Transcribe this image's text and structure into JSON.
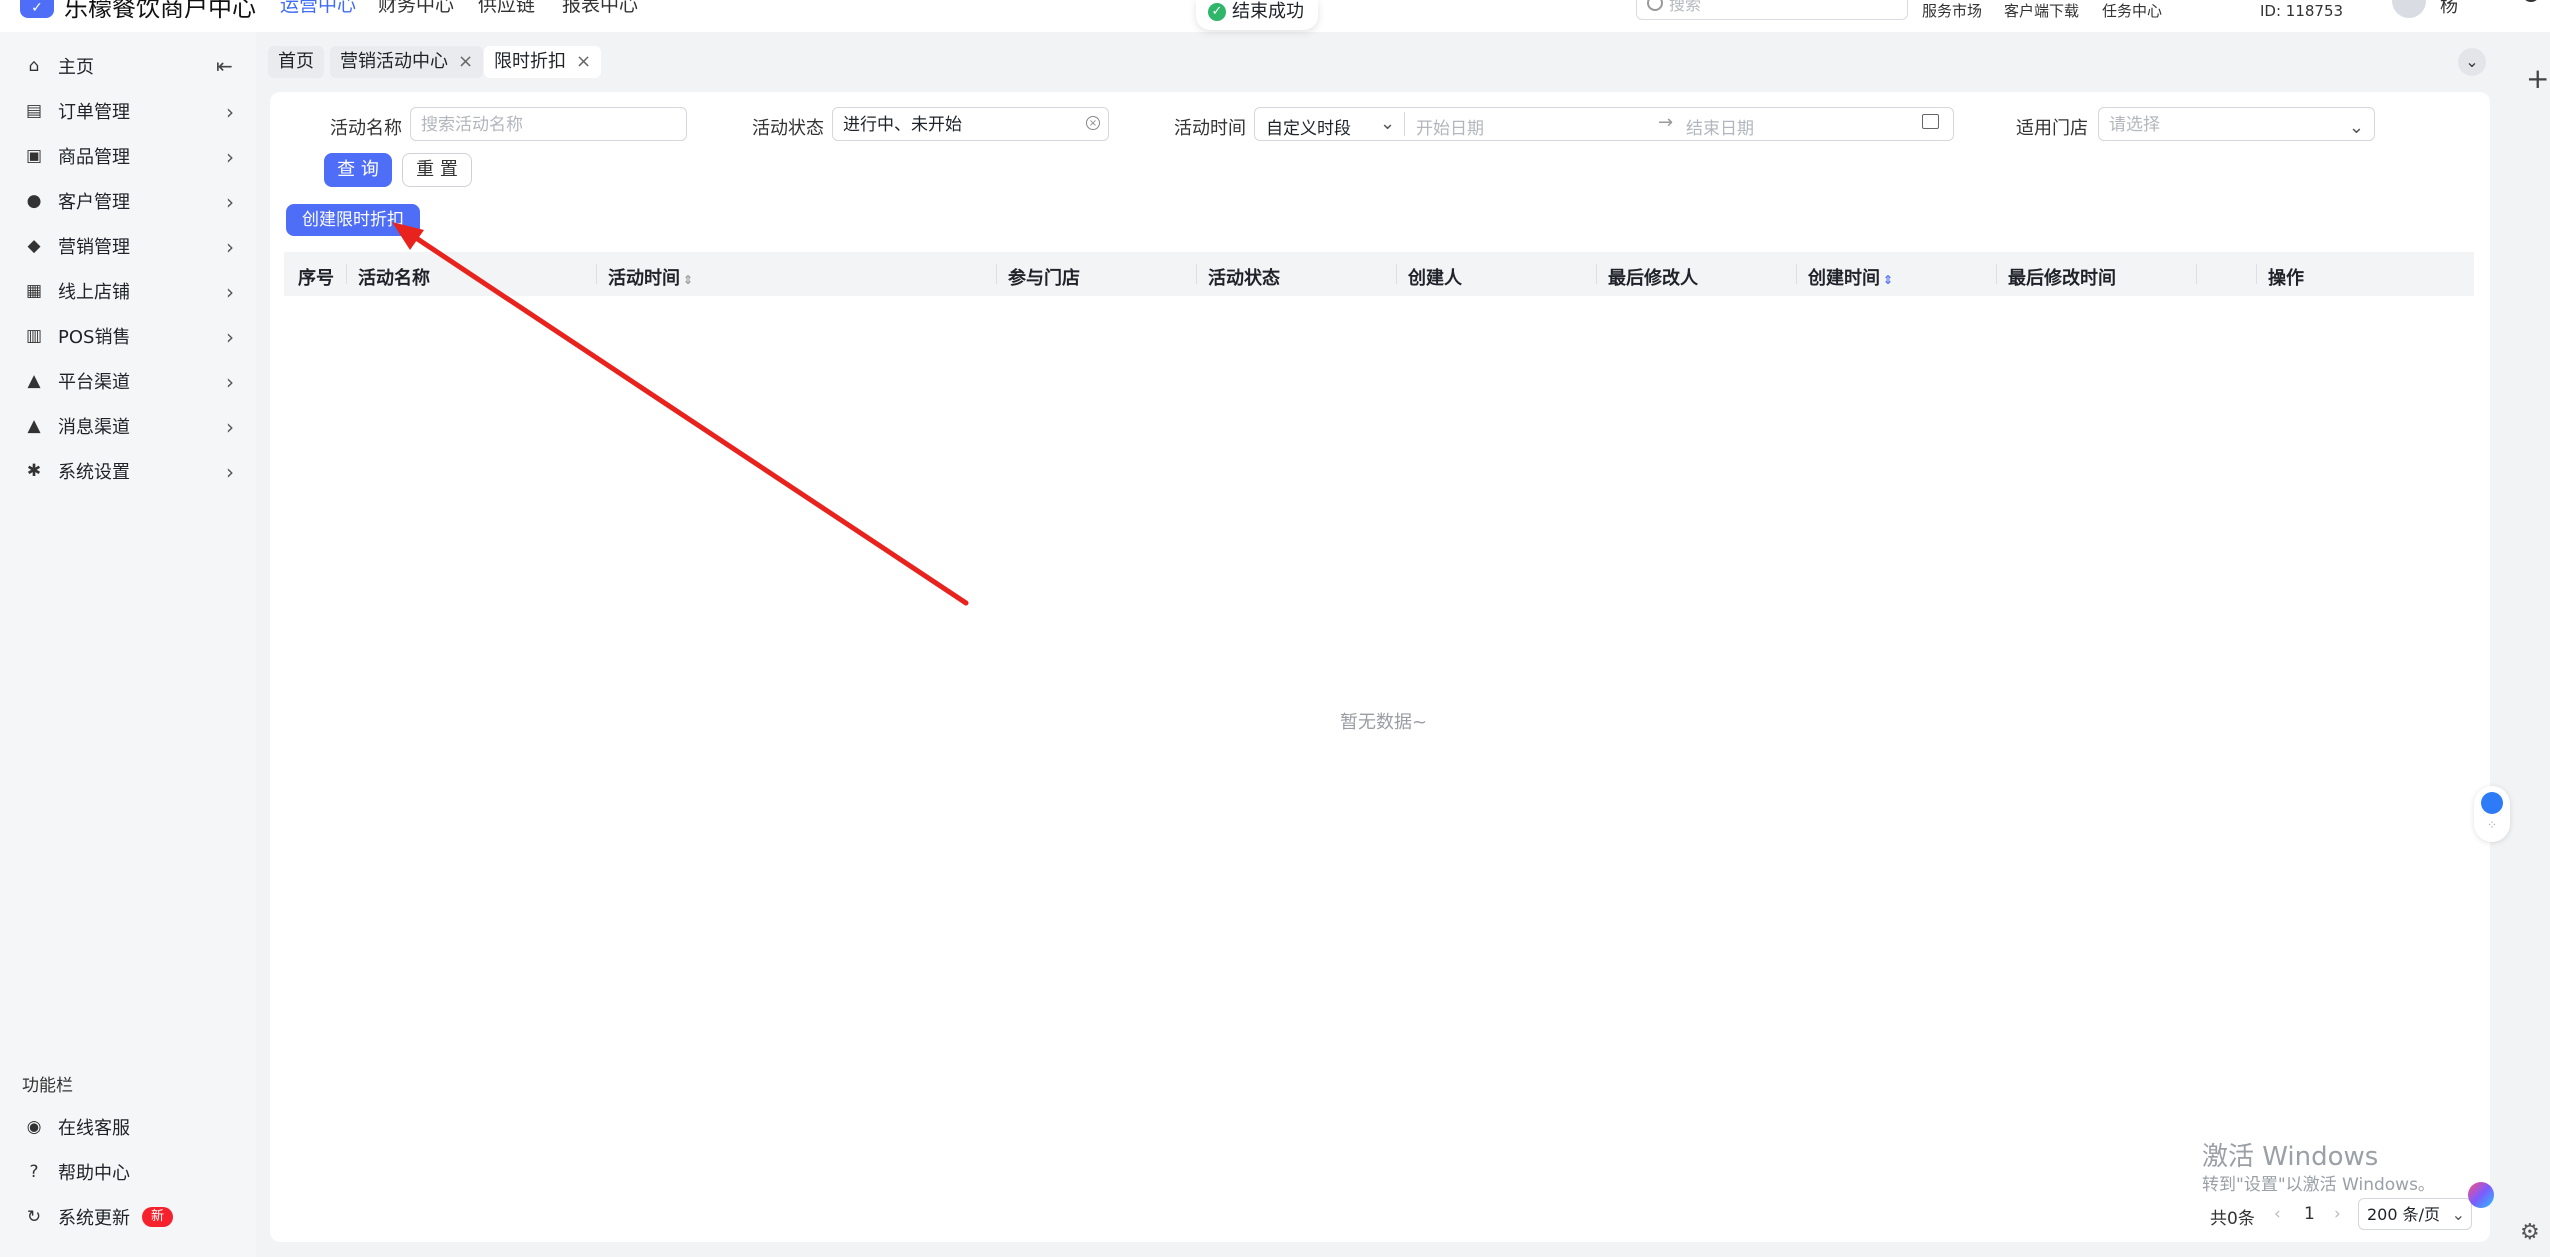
{
  "app": {
    "title": "乐檬餐饮商户中心",
    "logo_glyph": "✓"
  },
  "top_nav": [
    "运营中心",
    "财务中心",
    "供应链",
    "报表中心"
  ],
  "toast": {
    "text": "结束成功",
    "icon": "check-circle-icon"
  },
  "header_right": {
    "search_placeholder": "搜索",
    "links": [
      "服务市场",
      "客户端下载",
      "任务中心"
    ],
    "user_id": "ID: 118753",
    "user_name": "杨"
  },
  "sidebar": {
    "items": [
      {
        "label": "主页",
        "icon": "home-icon",
        "glyph": "⌂"
      },
      {
        "label": "订单管理",
        "icon": "order-icon",
        "glyph": "▤"
      },
      {
        "label": "商品管理",
        "icon": "goods-icon",
        "glyph": "▣"
      },
      {
        "label": "客户管理",
        "icon": "user-icon",
        "glyph": "●"
      },
      {
        "label": "营销管理",
        "icon": "tag-icon",
        "glyph": "◆"
      },
      {
        "label": "线上店铺",
        "icon": "store-icon",
        "glyph": "▦"
      },
      {
        "label": "POS销售",
        "icon": "pos-icon",
        "glyph": "▥"
      },
      {
        "label": "平台渠道",
        "icon": "bank-icon",
        "glyph": "▲"
      },
      {
        "label": "消息渠道",
        "icon": "bank-icon",
        "glyph": "▲"
      },
      {
        "label": "系统设置",
        "icon": "gear-icon",
        "glyph": "✱"
      }
    ],
    "function_title": "功能栏",
    "function_items": [
      {
        "label": "在线客服",
        "icon": "headset-icon",
        "glyph": "◉"
      },
      {
        "label": "帮助中心",
        "icon": "help-icon",
        "glyph": "?"
      },
      {
        "label": "系统更新",
        "icon": "refresh-icon",
        "glyph": "↻",
        "badge": "新"
      }
    ]
  },
  "tabs": [
    {
      "label": "首页",
      "closable": false
    },
    {
      "label": "营销活动中心",
      "closable": true
    },
    {
      "label": "限时折扣",
      "closable": true,
      "active": true
    }
  ],
  "filters": {
    "activity_name": {
      "label": "活动名称",
      "placeholder": "搜索活动名称"
    },
    "activity_status": {
      "label": "活动状态",
      "value": "进行中、未开始"
    },
    "activity_time": {
      "label": "活动时间",
      "mode": "自定义时段",
      "start_placeholder": "开始日期",
      "end_placeholder": "结束日期"
    },
    "stores": {
      "label": "适用门店",
      "placeholder": "请选择"
    },
    "query_label": "查 询",
    "reset_label": "重 置"
  },
  "create_button": "创建限时折扣",
  "table": {
    "columns": [
      "序号",
      "活动名称",
      "活动时间",
      "参与门店",
      "活动状态",
      "创建人",
      "最后修改人",
      "创建时间",
      "最后修改时间",
      "操作"
    ],
    "empty_text": "暂无数据~"
  },
  "pagination": {
    "total": "共0条",
    "page": "1",
    "page_size": "200 条/页"
  },
  "watermark": {
    "line1": "激活 Windows",
    "line2": "转到\"设置\"以激活 Windows。"
  },
  "colors": {
    "primary": "#4f6ef7",
    "annotation_arrow": "#e8231e",
    "success": "#2fb668",
    "badge": "#f5222d"
  }
}
